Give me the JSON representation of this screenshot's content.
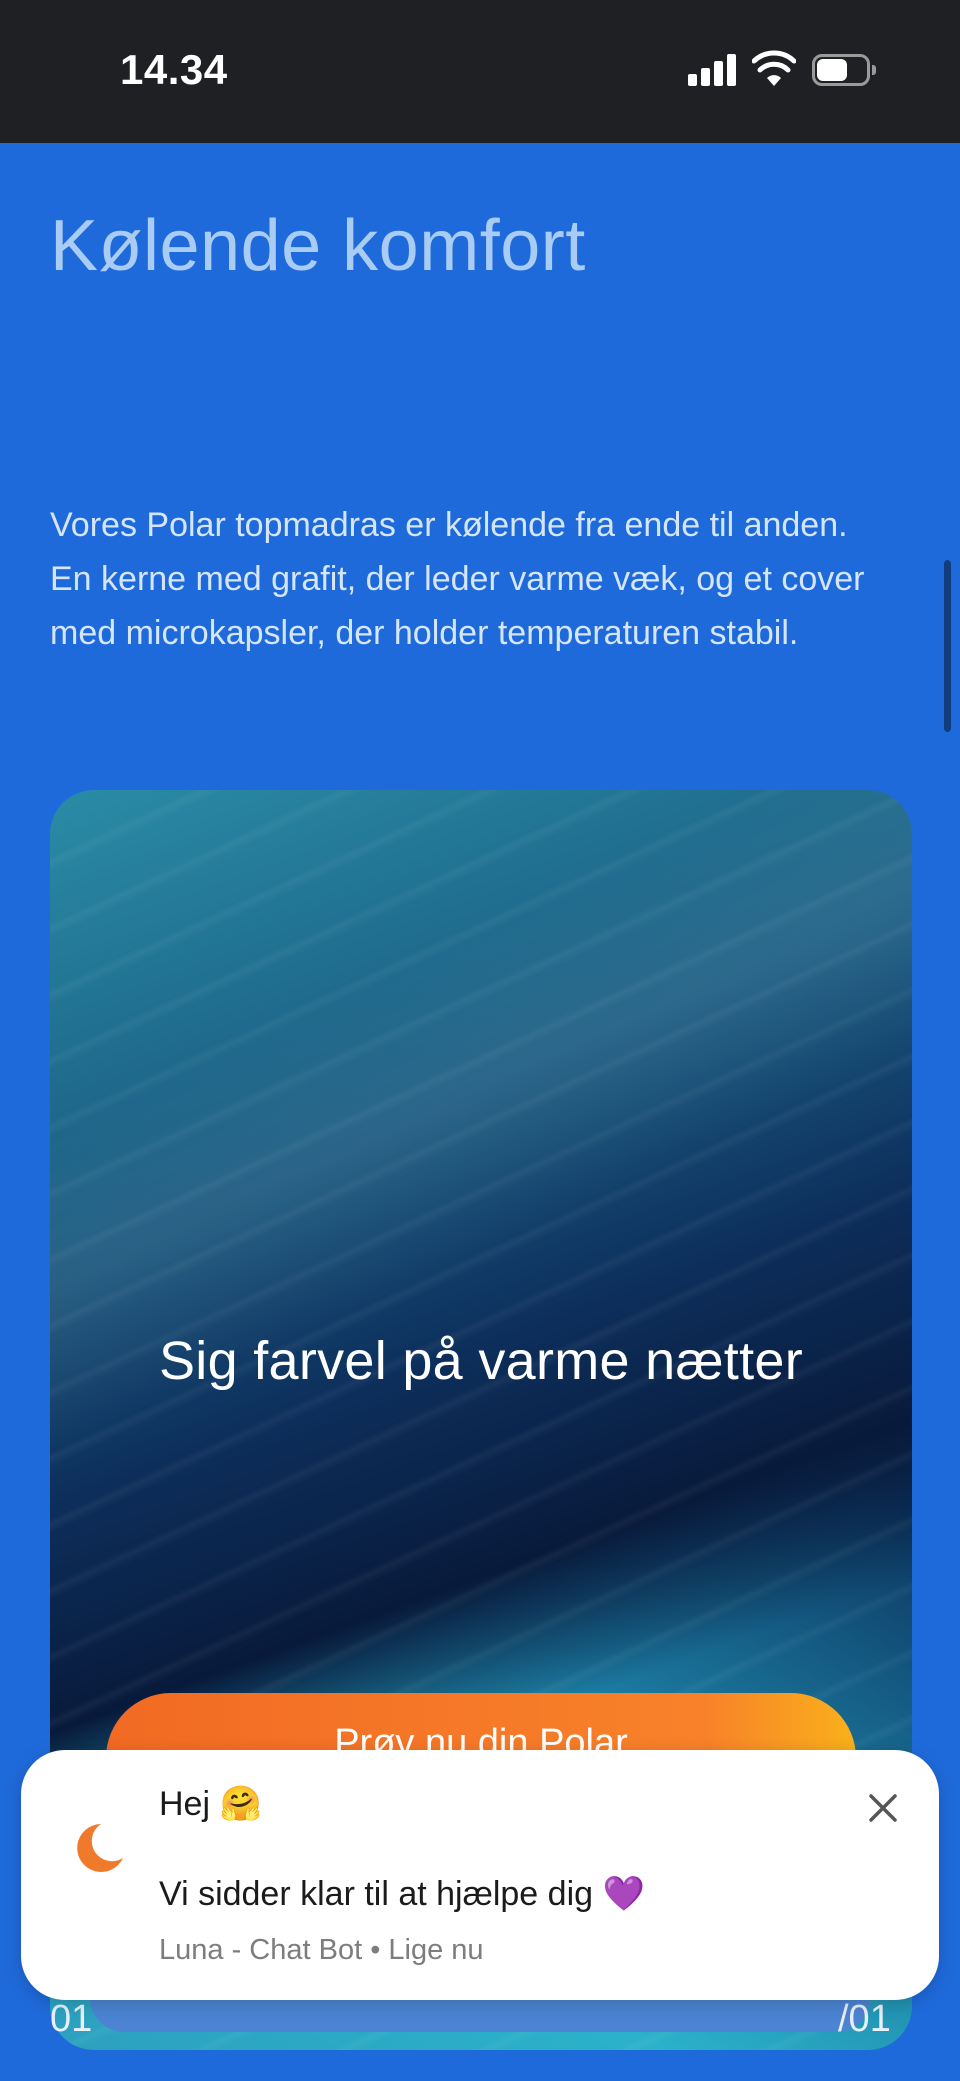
{
  "status_bar": {
    "time": "14.34",
    "icons": [
      "signal-icon",
      "wifi-icon",
      "battery-icon"
    ]
  },
  "main": {
    "heading": "Kølende komfort",
    "body": "Vores Polar topmadras er kølende fra ende til anden. En kerne med grafit, der leder varme væk, og et cover med microkapsler, der holder temperaturen stabil."
  },
  "hero": {
    "title": "Sig farvel på varme nætter",
    "cta_label": "Prøv nu din Polar"
  },
  "bottom": {
    "left_partial": "01",
    "right_partial": "/01"
  },
  "chat": {
    "greeting": "Hej 🤗",
    "message": "Vi sidder klar til at hjælpe dig 💜",
    "sender": "Luna - Chat Bot",
    "separator": "•",
    "time": "Lige nu",
    "icon": "moon-icon",
    "close_icon": "close-icon"
  },
  "colors": {
    "page_background": "#1f6adb",
    "status_bar_background": "#1f2023",
    "heading": "#a9ccf5",
    "cta_orange": "#f26a24",
    "moon_orange": "#ef7a2b"
  }
}
